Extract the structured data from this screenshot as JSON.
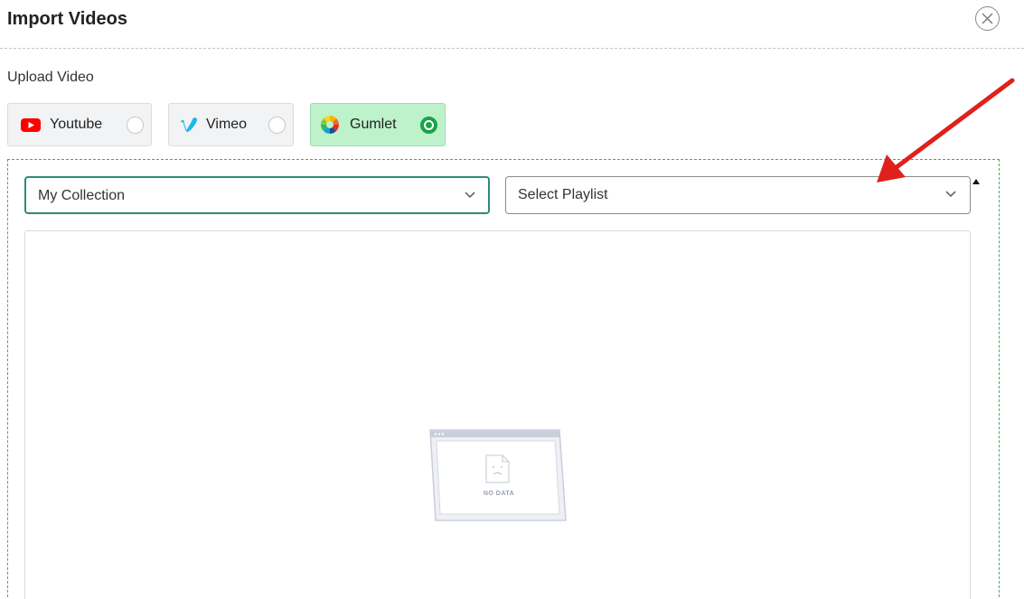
{
  "header": {
    "title": "Import Videos",
    "close_icon": "close-circle-icon"
  },
  "upload": {
    "label": "Upload Video",
    "sources": [
      {
        "label": "Youtube",
        "icon": "youtube-icon",
        "selected": false
      },
      {
        "label": "Vimeo",
        "icon": "vimeo-icon",
        "selected": false
      },
      {
        "label": "Gumlet",
        "icon": "gumlet-icon",
        "selected": true
      }
    ]
  },
  "filters": {
    "collection": {
      "value": "My Collection",
      "icon": "chevron-down-icon"
    },
    "playlist": {
      "value": "Select Playlist",
      "icon": "chevron-down-icon"
    }
  },
  "empty_state": {
    "text": "NO DATA",
    "icon": "sad-document-icon"
  },
  "annotation": {
    "icon": "red-arrow-icon",
    "color": "#e0201c"
  },
  "colors": {
    "accent_green": "#1aa34a",
    "selected_bg": "#bdf2cb",
    "border_teal": "#2e8a7a",
    "youtube_red": "#ff0000",
    "vimeo_blue": "#1ab7ea"
  }
}
